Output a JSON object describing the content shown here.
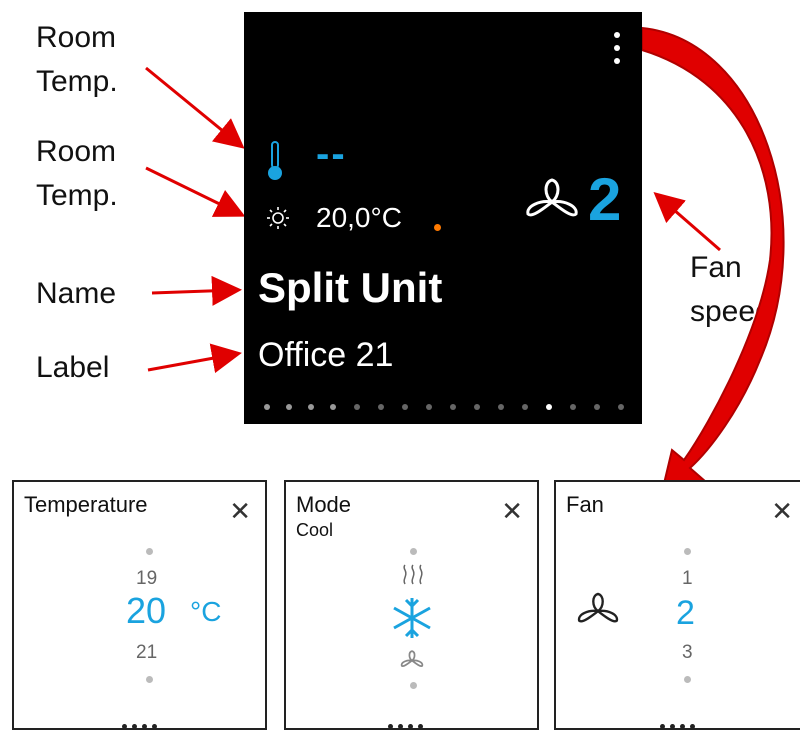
{
  "callouts": {
    "room_temp_1": "Room Temp.",
    "room_temp_2": "Room Temp.",
    "name": "Name",
    "label": "Label",
    "fan_speed": "Fan speed"
  },
  "screen": {
    "room_temp_value": "--",
    "set_temp_value": "20,0°C",
    "fan_speed_value": "2",
    "name": "Split Unit",
    "label": "Office 21"
  },
  "cards": {
    "temperature": {
      "title": "Temperature",
      "prev": "19",
      "current": "20",
      "unit": "°C",
      "next": "21"
    },
    "mode": {
      "title": "Mode",
      "subtitle": "Cool"
    },
    "fan": {
      "title": "Fan",
      "prev": "1",
      "current": "2",
      "next": "3"
    }
  },
  "icons": {
    "thermometer": "thermometer-icon",
    "setpoint": "sun-icon",
    "fan": "fan-icon",
    "heat": "heat-icon",
    "cool": "snowflake-icon",
    "close": "close-icon",
    "menu": "kebab-menu-icon"
  },
  "colors": {
    "accent": "#1aa3df",
    "status": "#ff7a00",
    "arrow": "#e00000"
  }
}
